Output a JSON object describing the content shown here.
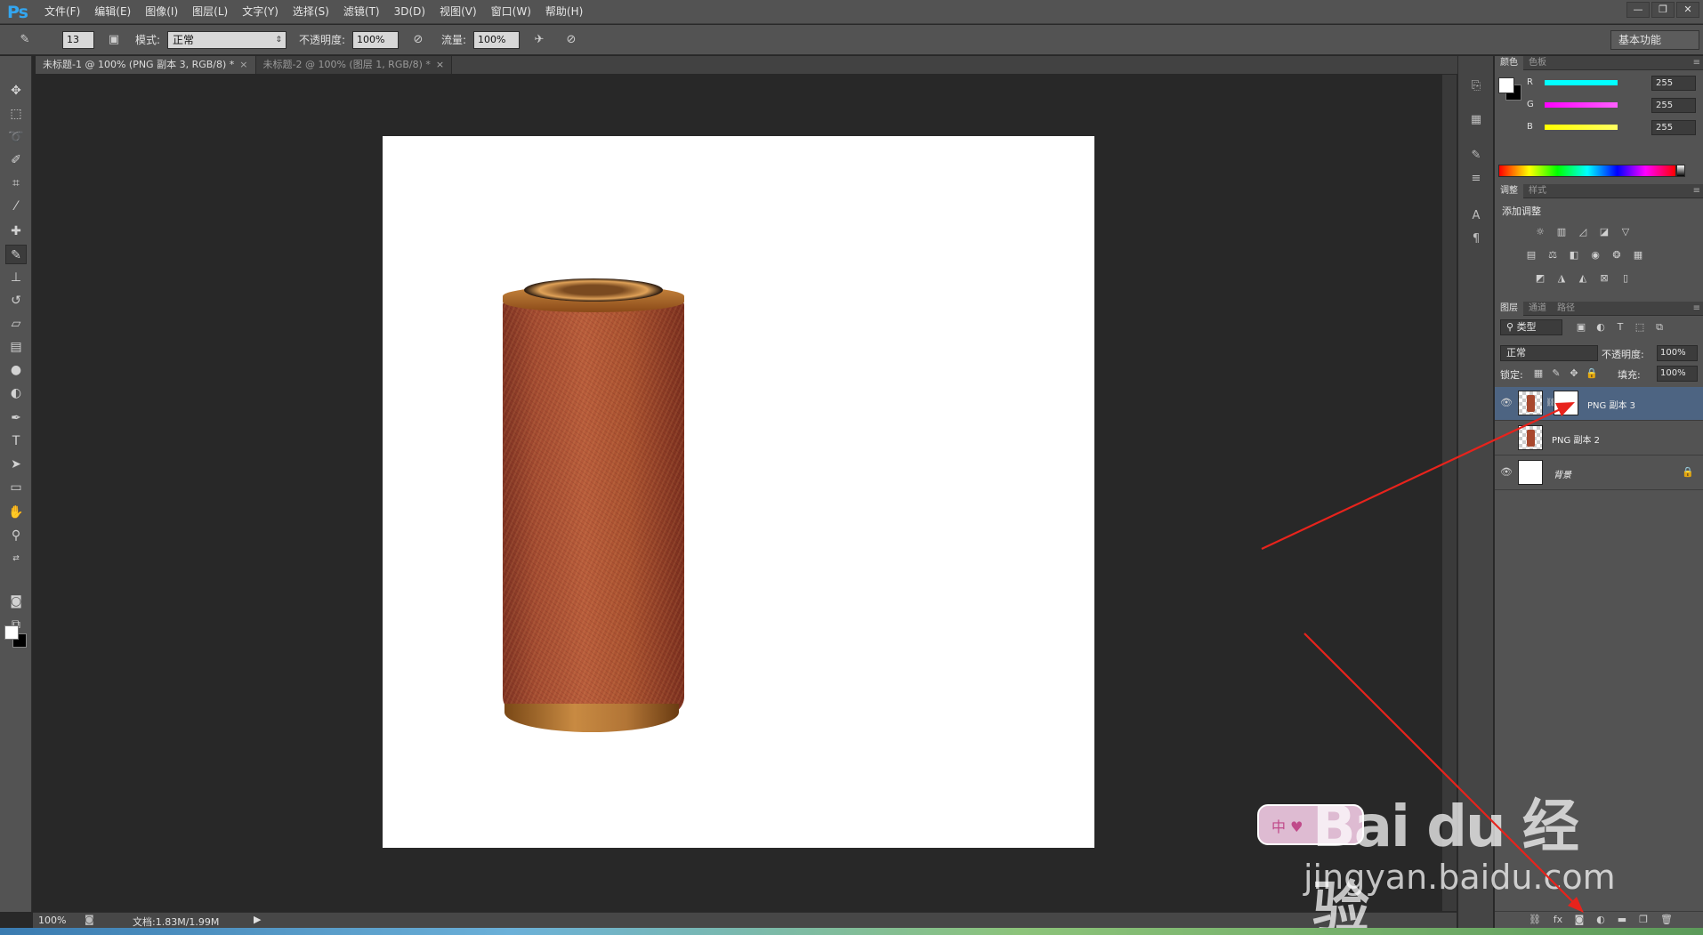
{
  "app": {
    "logo": "Ps"
  },
  "menu": [
    "文件(F)",
    "编辑(E)",
    "图像(I)",
    "图层(L)",
    "文字(Y)",
    "选择(S)",
    "滤镜(T)",
    "3D(D)",
    "视图(V)",
    "窗口(W)",
    "帮助(H)"
  ],
  "window_controls": [
    "—",
    "❐",
    "✕"
  ],
  "options": {
    "brush_size": "13",
    "mode_label": "模式:",
    "mode_value": "正常",
    "opacity_label": "不透明度:",
    "opacity_value": "100%",
    "flow_label": "流量:",
    "flow_value": "100%",
    "workspace": "基本功能"
  },
  "tabs": [
    {
      "label": "未标题-1 @ 100% (PNG 副本 3, RGB/8) *",
      "close": "×"
    },
    {
      "label": "未标题-2 @ 100% (图层 1, RGB/8) *",
      "close": "×"
    }
  ],
  "tools": [
    "move-icon",
    "marquee-icon",
    "lasso-icon",
    "quick-select-icon",
    "crop-icon",
    "eyedropper-icon",
    "healing-icon",
    "brush-icon",
    "stamp-icon",
    "history-brush-icon",
    "eraser-icon",
    "gradient-icon",
    "blur-icon",
    "dodge-icon",
    "pen-icon",
    "type-icon",
    "path-select-icon",
    "shape-icon",
    "hand-icon",
    "zoom-icon"
  ],
  "status": {
    "zoom": "100%",
    "doc_size": "文档:1.83M/1.99M"
  },
  "color_panel": {
    "tabs": [
      "颜色",
      "色板"
    ],
    "channels": [
      {
        "label": "R",
        "value": "255",
        "gradient_end": "#00ffff"
      },
      {
        "label": "G",
        "value": "255",
        "gradient_end": "#ff00ff"
      },
      {
        "label": "B",
        "value": "255",
        "gradient_end": "#ffff00"
      }
    ]
  },
  "adjustments_panel": {
    "tabs": [
      "调整",
      "样式"
    ],
    "title": "添加调整"
  },
  "layers_panel": {
    "tabs": [
      "图层",
      "通道",
      "路径"
    ],
    "filter_kind": "类型",
    "blend_mode": "正常",
    "opacity_label": "不透明度:",
    "opacity_value": "100%",
    "lock_label": "锁定:",
    "fill_label": "填充:",
    "fill_value": "100%",
    "layers": [
      {
        "name": "PNG 副本 3",
        "visible": true,
        "selected": true,
        "has_mask": true
      },
      {
        "name": "PNG 副本 2",
        "visible": false,
        "selected": false,
        "has_mask": false
      },
      {
        "name": "背景",
        "visible": true,
        "selected": false,
        "has_mask": false,
        "locked": true
      }
    ]
  },
  "watermark": {
    "brand": "Bai du 经验",
    "sub": "jingyan.baidu.com",
    "badge": "中 ♥"
  },
  "colors": {
    "annotation_red": "#e8231c",
    "selected_layer": "#4d6482",
    "accent": "#33a6f0"
  }
}
